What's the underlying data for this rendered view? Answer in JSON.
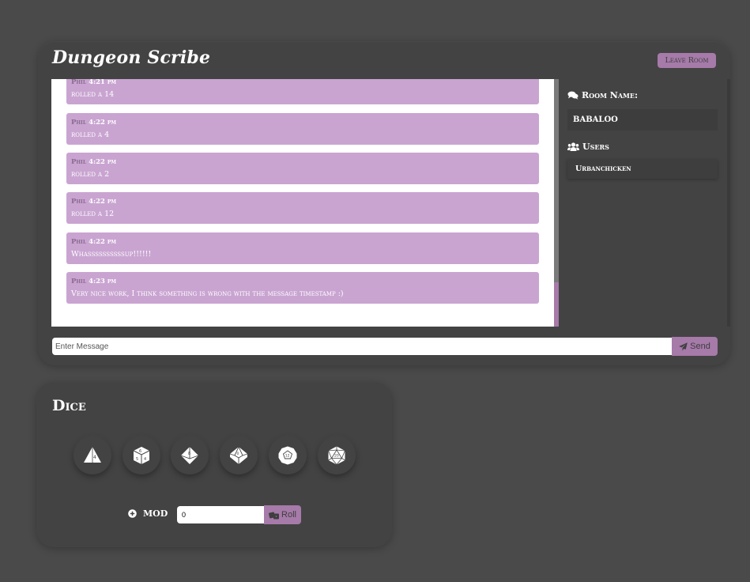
{
  "app": {
    "title": "Dungeon Scribe",
    "leave_label": "Leave Room"
  },
  "messages": [
    {
      "user": "Phil",
      "time": "4:21 pm",
      "text": "rolled a 14"
    },
    {
      "user": "Phil",
      "time": "4:22 pm",
      "text": "rolled a 4"
    },
    {
      "user": "Phil",
      "time": "4:22 pm",
      "text": "rolled a 2"
    },
    {
      "user": "Phil",
      "time": "4:22 pm",
      "text": "rolled a 12"
    },
    {
      "user": "Phil",
      "time": "4:22 pm",
      "text": "Whassssssssssup!!!!!!"
    },
    {
      "user": "Phil",
      "time": "4:23 pm",
      "text": "Very nice work, I think something is wrong with the message timestamp :)"
    }
  ],
  "sidebar": {
    "room_label": "Room Name:",
    "room_name": "BABALOO",
    "users_label": "Users",
    "users": [
      "Urbanchicken"
    ]
  },
  "composer": {
    "placeholder": "Enter Message",
    "send_label": "Send"
  },
  "dice": {
    "title": "Dice",
    "buttons": [
      {
        "icon": "d4-icon",
        "face": "4"
      },
      {
        "icon": "d6-icon",
        "face": "6"
      },
      {
        "icon": "d8-icon",
        "face": "8"
      },
      {
        "icon": "d10-icon",
        "face": "10"
      },
      {
        "icon": "d12-icon",
        "face": "12"
      },
      {
        "icon": "d20-icon",
        "face": "20"
      }
    ],
    "mod_label": "MOD",
    "mod_value": "0",
    "roll_label": "Roll"
  },
  "colors": {
    "accent": "#a67aa9",
    "message_bg": "#c9a4d1",
    "card_bg": "#434343",
    "page_bg": "#4a4a4a"
  }
}
